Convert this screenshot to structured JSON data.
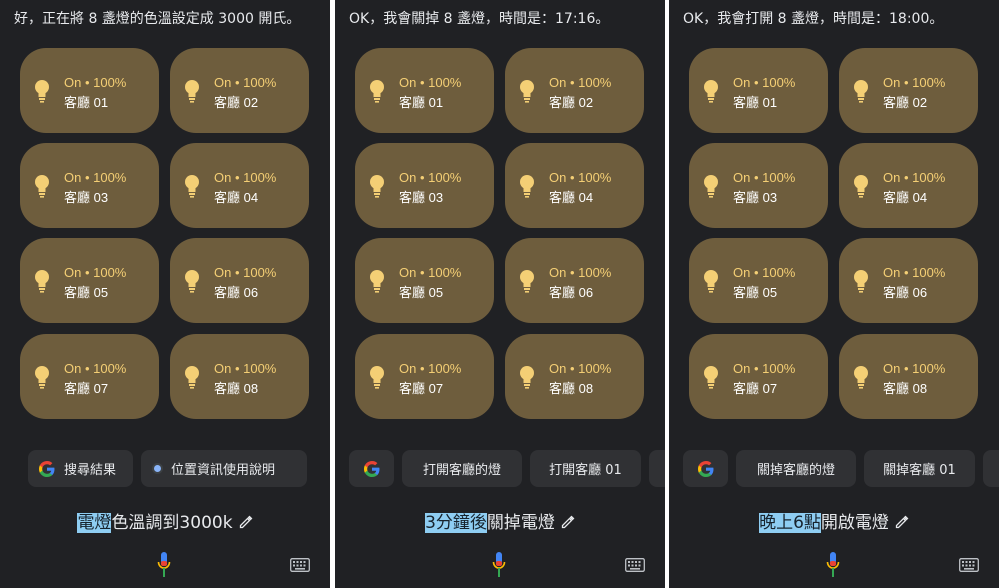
{
  "panels": [
    {
      "response": "好，正在將 8 盞燈的色溫設定成 3000 開氏。",
      "tiles": [
        {
          "status": "On • 100%",
          "name": "客廳 01"
        },
        {
          "status": "On • 100%",
          "name": "客廳 02"
        },
        {
          "status": "On • 100%",
          "name": "客廳 03"
        },
        {
          "status": "On • 100%",
          "name": "客廳 04"
        },
        {
          "status": "On • 100%",
          "name": "客廳 05"
        },
        {
          "status": "On • 100%",
          "name": "客廳 06"
        },
        {
          "status": "On • 100%",
          "name": "客廳 07"
        },
        {
          "status": "On • 100%",
          "name": "客廳 08"
        }
      ],
      "chips": [
        "搜尋結果",
        "位置資訊使用說明"
      ],
      "query_highlight": "電燈",
      "query_rest": "色溫調到3000k"
    },
    {
      "response": "OK，我會關掉 8 盞燈，時間是：17:16。",
      "tiles": [
        {
          "status": "On • 100%",
          "name": "客廳 01"
        },
        {
          "status": "On • 100%",
          "name": "客廳 02"
        },
        {
          "status": "On • 100%",
          "name": "客廳 03"
        },
        {
          "status": "On • 100%",
          "name": "客廳 04"
        },
        {
          "status": "On • 100%",
          "name": "客廳 05"
        },
        {
          "status": "On • 100%",
          "name": "客廳 06"
        },
        {
          "status": "On • 100%",
          "name": "客廳 07"
        },
        {
          "status": "On • 100%",
          "name": "客廳 08"
        }
      ],
      "chips": [
        "打開客廳的燈",
        "打開客廳 01"
      ],
      "query_highlight": "3分鐘後",
      "query_rest": "關掉電燈"
    },
    {
      "response": "OK，我會打開 8 盞燈，時間是：18:00。",
      "tiles": [
        {
          "status": "On • 100%",
          "name": "客廳 01"
        },
        {
          "status": "On • 100%",
          "name": "客廳 02"
        },
        {
          "status": "On • 100%",
          "name": "客廳 03"
        },
        {
          "status": "On • 100%",
          "name": "客廳 04"
        },
        {
          "status": "On • 100%",
          "name": "客廳 05"
        },
        {
          "status": "On • 100%",
          "name": "客廳 06"
        },
        {
          "status": "On • 100%",
          "name": "客廳 07"
        },
        {
          "status": "On • 100%",
          "name": "客廳 08"
        }
      ],
      "chips": [
        "關掉客廳的燈",
        "關掉客廳 01"
      ],
      "query_highlight": "晚上6點",
      "query_rest": "開啟電燈"
    }
  ],
  "icons": {
    "tile": "lightbulb-icon",
    "google": "google-g-icon",
    "location": "location-dot-icon",
    "edit": "pencil-edit-icon",
    "mic": "microphone-icon",
    "keyboard": "keyboard-icon"
  },
  "colors": {
    "panel_bg": "#202124",
    "tile_bg": "#6e5d3d",
    "tile_status": "#f4cf75",
    "chip_bg": "#303134",
    "highlight": "#8ecdf2"
  }
}
